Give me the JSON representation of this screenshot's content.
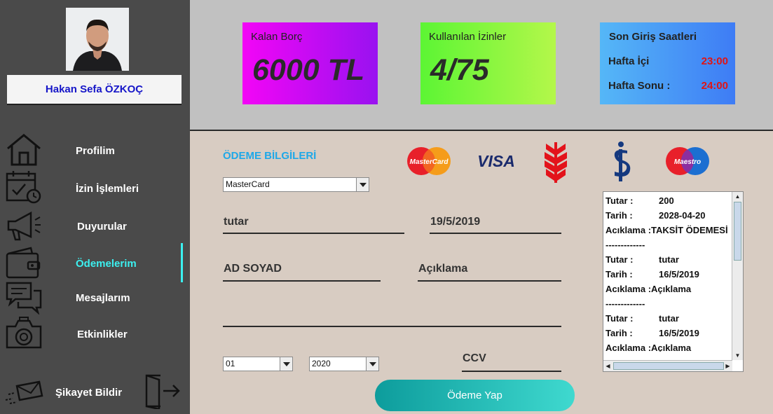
{
  "user": {
    "name": "Hakan Sefa ÖZKOÇ"
  },
  "nav": {
    "items": [
      {
        "label": "Profilim",
        "icon": "home-icon"
      },
      {
        "label": "İzin İşlemleri",
        "icon": "calendar-icon"
      },
      {
        "label": "Duyurular",
        "icon": "megaphone-icon"
      },
      {
        "label": "Ödemelerim",
        "icon": "wallet-icon",
        "active": true
      },
      {
        "label": "Mesajlarım",
        "icon": "chat-icon"
      },
      {
        "label": "Etkinlikler",
        "icon": "camera-icon"
      }
    ],
    "complaint": "Şikayet Bildir"
  },
  "cards": {
    "borc": {
      "title": "Kalan Borç",
      "value": "6000 TL"
    },
    "izin": {
      "title": "Kullanılan İzinler",
      "value": "4/75"
    },
    "giris": {
      "title": "Son Giriş Saatleri",
      "weekday_label": "Hafta İçi",
      "weekday_value": "23:00",
      "weekend_label": "Hafta Sonu :",
      "weekend_value": "24:00"
    }
  },
  "payment": {
    "title": "ÖDEME BİLGİLERİ",
    "card_type": "MasterCard",
    "amount": "tutar",
    "date": "19/5/2019",
    "name": "AD SOYAD",
    "description": "Açıklama",
    "month": "01",
    "year": "2020",
    "ccv": "CCV",
    "button": "Ödeme Yap",
    "logos": {
      "mastercard": "MasterCard",
      "visa": "VISA",
      "maestro": "Maestro"
    }
  },
  "history": {
    "entries": [
      {
        "tutar_label": "Tutar :",
        "tutar": "200",
        "tarih_label": "Tarih :",
        "tarih": "2028-04-20",
        "aciklama_label": "Acıklama :",
        "aciklama": "TAKSİT ÖDEMESİ"
      },
      {
        "tutar_label": "Tutar :",
        "tutar": "tutar",
        "tarih_label": "Tarih :",
        "tarih": "16/5/2019",
        "aciklama_label": "Acıklama :",
        "aciklama": "Açıklama"
      },
      {
        "tutar_label": "Tutar :",
        "tutar": "tutar",
        "tarih_label": "Tarih :",
        "tarih": "16/5/2019",
        "aciklama_label": "Acıklama :",
        "aciklama": "Açıklama"
      }
    ],
    "separator": "-------------"
  },
  "colors": {
    "accent": "#3cf0f0",
    "sidebar": "#4a4a4a",
    "title_blue": "#1ea8e8",
    "time_red": "#e01414"
  }
}
